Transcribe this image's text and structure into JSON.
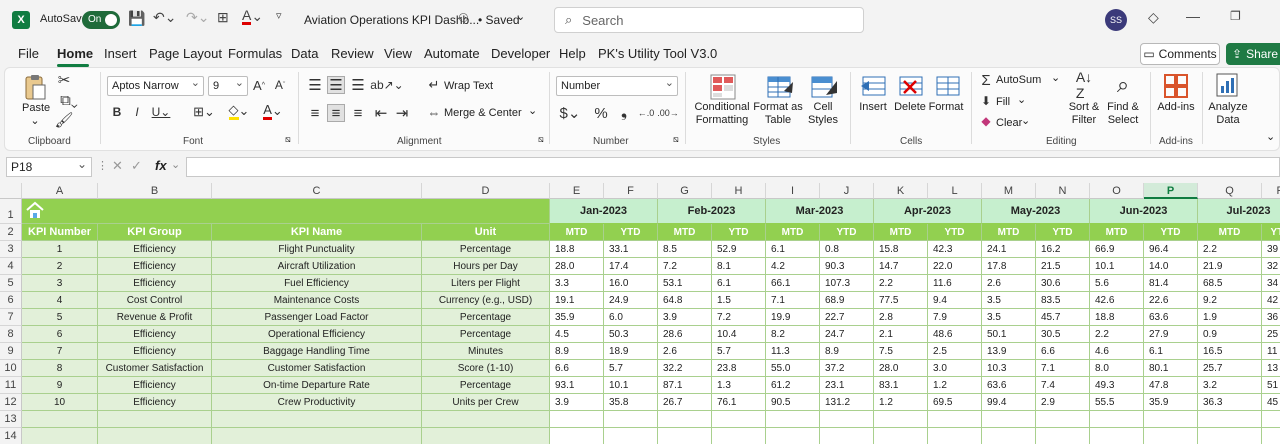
{
  "titlebar": {
    "autosave_label": "AutoSave",
    "toggle_state": "On",
    "doc_title": "Aviation Operations KPI Dashb...",
    "saved_label": "• Saved",
    "search_placeholder": "Search",
    "avatar_initials": "SS"
  },
  "menu": {
    "items": [
      "File",
      "Home",
      "Insert",
      "Page Layout",
      "Formulas",
      "Data",
      "Review",
      "View",
      "Automate",
      "Developer",
      "Help",
      "PK's Utility Tool V3.0"
    ],
    "active": "Home",
    "comments_label": "Comments",
    "share_label": "Share"
  },
  "ribbon": {
    "clipboard": {
      "paste": "Paste",
      "label": "Clipboard"
    },
    "font": {
      "name": "Aptos Narrow",
      "size": "9",
      "label": "Font"
    },
    "alignment": {
      "wrap": "Wrap Text",
      "merge": "Merge & Center",
      "label": "Alignment"
    },
    "number": {
      "format": "Number",
      "label": "Number"
    },
    "styles": {
      "conditional": "Conditional",
      "conditional2": "Formatting",
      "format_as": "Format as",
      "format_as2": "Table",
      "cell": "Cell",
      "cell2": "Styles",
      "label": "Styles"
    },
    "cells": {
      "insert": "Insert",
      "delete": "Delete",
      "format": "Format",
      "label": "Cells"
    },
    "editing": {
      "autosum": "AutoSum",
      "fill": "Fill",
      "clear": "Clear",
      "sort": "Sort &",
      "sort2": "Filter",
      "find": "Find &",
      "find2": "Select",
      "label": "Editing"
    },
    "addins": {
      "btn": "Add-ins",
      "label": "Add-ins"
    },
    "analyze": {
      "btn": "Analyze",
      "btn2": "Data"
    }
  },
  "formula_bar": {
    "name_box": "P18",
    "fx": "fx"
  },
  "sheet": {
    "columns": [
      "A",
      "B",
      "C",
      "D",
      "E",
      "F",
      "G",
      "H",
      "I",
      "J",
      "K",
      "L",
      "M",
      "N",
      "O",
      "P",
      "Q",
      "R"
    ],
    "selected_column": "P",
    "rows": [
      "1",
      "2",
      "3",
      "4",
      "5",
      "6",
      "7",
      "8",
      "9",
      "10",
      "11",
      "12",
      "13",
      "14"
    ],
    "headers": [
      "KPI Number",
      "KPI Group",
      "KPI Name",
      "Unit"
    ],
    "months": [
      "Jan-2023",
      "Feb-2023",
      "Mar-2023",
      "Apr-2023",
      "May-2023",
      "Jun-2023",
      "Jul-2023"
    ],
    "mtd": "MTD",
    "ytd": "YTD",
    "data": [
      {
        "n": "1",
        "group": "Efficiency",
        "name": "Flight Punctuality",
        "unit": "Percentage",
        "vals": [
          "18.8",
          "33.1",
          "8.5",
          "52.9",
          "6.1",
          "0.8",
          "15.8",
          "42.3",
          "24.1",
          "16.2",
          "66.9",
          "96.4",
          "2.2",
          "39"
        ]
      },
      {
        "n": "2",
        "group": "Efficiency",
        "name": "Aircraft Utilization",
        "unit": "Hours per Day",
        "vals": [
          "28.0",
          "17.4",
          "7.2",
          "8.1",
          "4.2",
          "90.3",
          "14.7",
          "22.0",
          "17.8",
          "21.5",
          "10.1",
          "14.0",
          "21.9",
          "32"
        ]
      },
      {
        "n": "3",
        "group": "Efficiency",
        "name": "Fuel Efficiency",
        "unit": "Liters per Flight",
        "vals": [
          "3.3",
          "16.0",
          "53.1",
          "6.1",
          "66.1",
          "107.3",
          "2.2",
          "11.6",
          "2.6",
          "30.6",
          "5.6",
          "81.4",
          "68.5",
          "34"
        ]
      },
      {
        "n": "4",
        "group": "Cost Control",
        "name": "Maintenance Costs",
        "unit": "Currency (e.g., USD)",
        "vals": [
          "19.1",
          "24.9",
          "64.8",
          "1.5",
          "7.1",
          "68.9",
          "77.5",
          "9.4",
          "3.5",
          "83.5",
          "42.6",
          "22.6",
          "9.2",
          "42"
        ]
      },
      {
        "n": "5",
        "group": "Revenue & Profit",
        "name": "Passenger Load Factor",
        "unit": "Percentage",
        "vals": [
          "35.9",
          "6.0",
          "3.9",
          "7.2",
          "19.9",
          "22.7",
          "2.8",
          "7.9",
          "3.5",
          "45.7",
          "18.8",
          "63.6",
          "1.9",
          "36"
        ]
      },
      {
        "n": "6",
        "group": "Efficiency",
        "name": "Operational Efficiency",
        "unit": "Percentage",
        "vals": [
          "4.5",
          "50.3",
          "28.6",
          "10.4",
          "8.2",
          "24.7",
          "2.1",
          "48.6",
          "50.1",
          "30.5",
          "2.2",
          "27.9",
          "0.9",
          "25"
        ]
      },
      {
        "n": "7",
        "group": "Efficiency",
        "name": "Baggage Handling Time",
        "unit": "Minutes",
        "vals": [
          "8.9",
          "18.9",
          "2.6",
          "5.7",
          "11.3",
          "8.9",
          "7.5",
          "2.5",
          "13.9",
          "6.6",
          "4.6",
          "6.1",
          "16.5",
          "11"
        ]
      },
      {
        "n": "8",
        "group": "Customer Satisfaction",
        "name": "Customer Satisfaction",
        "unit": "Score (1-10)",
        "vals": [
          "6.6",
          "5.7",
          "32.2",
          "23.8",
          "55.0",
          "37.2",
          "28.0",
          "3.0",
          "10.3",
          "7.1",
          "8.0",
          "80.1",
          "25.7",
          "13"
        ]
      },
      {
        "n": "9",
        "group": "Efficiency",
        "name": "On-time Departure Rate",
        "unit": "Percentage",
        "vals": [
          "93.1",
          "10.1",
          "87.1",
          "1.3",
          "61.2",
          "23.1",
          "83.1",
          "1.2",
          "63.6",
          "7.4",
          "49.3",
          "47.8",
          "3.2",
          "51"
        ]
      },
      {
        "n": "10",
        "group": "Efficiency",
        "name": "Crew Productivity",
        "unit": "Units per Crew",
        "vals": [
          "3.9",
          "35.8",
          "26.7",
          "76.1",
          "90.5",
          "131.2",
          "1.2",
          "69.5",
          "99.4",
          "2.9",
          "55.5",
          "35.9",
          "36.3",
          "45"
        ]
      }
    ]
  }
}
